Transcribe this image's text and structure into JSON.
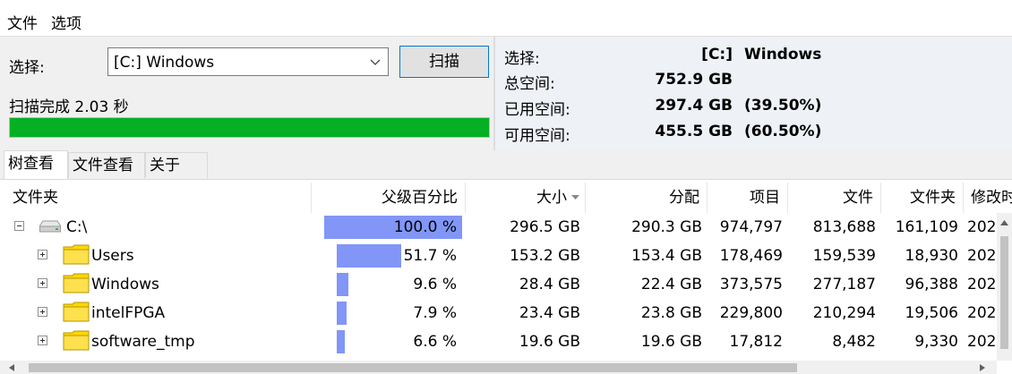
{
  "menu": {
    "file": "文件",
    "options": "选项"
  },
  "scan_panel": {
    "select_label": "选择:",
    "drive_value": "[C:] Windows",
    "scan_button": "扫描",
    "status": "扫描完成 2.03 秒",
    "progress_fraction": 1.0,
    "progress_color": "#06b025"
  },
  "info_panel": {
    "rows": [
      {
        "label": "选择:",
        "value": "[C:]",
        "extra": "Windows"
      },
      {
        "label": "总空间:",
        "value": "752.9 GB",
        "extra": ""
      },
      {
        "label": "已用空间:",
        "value": "297.4 GB",
        "extra": "(39.50%)"
      },
      {
        "label": "可用空间:",
        "value": "455.5 GB",
        "extra": "(60.50%)"
      }
    ]
  },
  "tabs": [
    "树查看",
    "文件查看",
    "关于"
  ],
  "columns": {
    "folder": "文件夹",
    "parent_percent": "父级百分比",
    "size": "大小",
    "allocated": "分配",
    "items": "项目",
    "files": "文件",
    "folders": "文件夹",
    "modified": "修改时"
  },
  "rows": [
    {
      "name": "C:\\",
      "percent_label": "100.0 %",
      "percent": 100.0,
      "size": "296.5 GB",
      "allocated": "290.3 GB",
      "items": "974,797",
      "files": "813,688",
      "folders": "161,109",
      "modified": "202",
      "icon": "drive-icon",
      "expanded": true
    },
    {
      "name": "Users",
      "percent_label": "51.7 %",
      "percent": 51.7,
      "size": "153.2 GB",
      "allocated": "153.4 GB",
      "items": "178,469",
      "files": "159,539",
      "folders": "18,930",
      "modified": "202",
      "icon": "folder-icon",
      "expanded": false
    },
    {
      "name": "Windows",
      "percent_label": "9.6 %",
      "percent": 9.6,
      "size": "28.4 GB",
      "allocated": "22.4 GB",
      "items": "373,575",
      "files": "277,187",
      "folders": "96,388",
      "modified": "202",
      "icon": "folder-icon",
      "expanded": false
    },
    {
      "name": "intelFPGA",
      "percent_label": "7.9 %",
      "percent": 7.9,
      "size": "23.4 GB",
      "allocated": "23.8 GB",
      "items": "229,800",
      "files": "210,294",
      "folders": "19,506",
      "modified": "202",
      "icon": "folder-icon",
      "expanded": false
    },
    {
      "name": "software_tmp",
      "percent_label": "6.6 %",
      "percent": 6.6,
      "size": "19.6 GB",
      "allocated": "19.6 GB",
      "items": "17,812",
      "files": "8,482",
      "folders": "9,330",
      "modified": "202",
      "icon": "folder-icon",
      "expanded": false
    }
  ],
  "colors": {
    "bar": "#8196f7",
    "folder": "#ffd800"
  }
}
